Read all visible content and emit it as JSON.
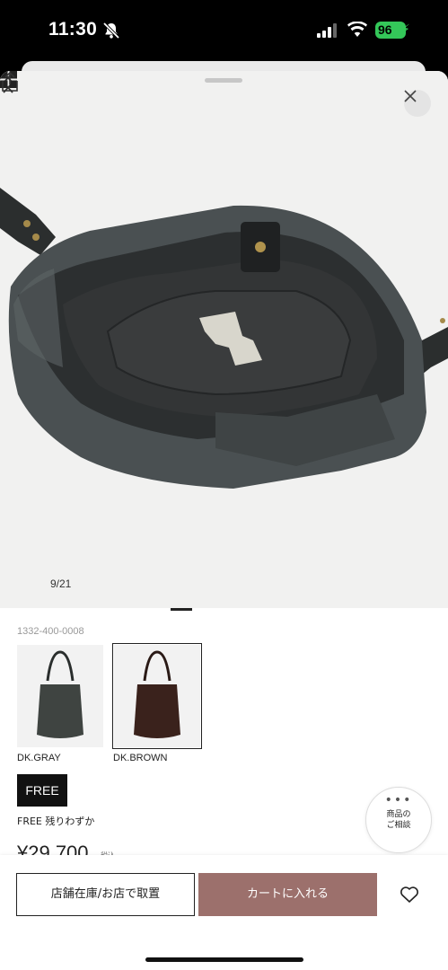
{
  "status_bar": {
    "time": "11:30",
    "battery": "96",
    "icons": [
      "bell-slash-icon",
      "signal-icon",
      "wifi-icon",
      "battery-icon"
    ]
  },
  "gallery": {
    "counter": "9/21",
    "current": 9,
    "total": 21,
    "icons": [
      "close-icon",
      "chevron-left-icon",
      "chevron-right-icon",
      "grid-icon",
      "share-icon"
    ]
  },
  "product": {
    "sku": "1332-400-0008",
    "colors": [
      {
        "label": "DK.GRAY",
        "swatch": "#3f4441"
      },
      {
        "label": "DK.BROWN",
        "swatch": "#3a221c",
        "selected": true
      }
    ],
    "size": "FREE",
    "stock": "FREE 残りわずか",
    "price": "¥29,700",
    "price_tax": "税込"
  },
  "consult": {
    "dots": "•••",
    "line1": "商品の",
    "line2": "ご相談"
  },
  "actions": {
    "store_button": "店舗在庫/お店で取置",
    "cart_button": "カートに入れる",
    "cart_color": "#9c706c"
  }
}
